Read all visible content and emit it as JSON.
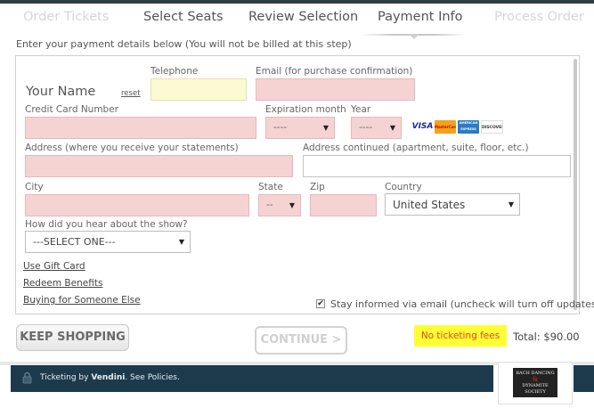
{
  "steps": [
    {
      "label": "Order Tickets",
      "state": "disabled"
    },
    {
      "label": "Select Seats",
      "state": "normal"
    },
    {
      "label": "Review Selection",
      "state": "normal"
    },
    {
      "label": "Payment Info",
      "state": "active"
    },
    {
      "label": "Process Order",
      "state": "disabled"
    }
  ],
  "intro_text": "Enter your payment details below (You will not be billed at this step)",
  "form": {
    "your_name": "Your Name",
    "reset_link": "reset",
    "telephone_label": "Telephone",
    "email_label": "Email (for purchase confirmation)",
    "card_number_label": "Credit Card Number",
    "expiration_month_label": "Expiration month",
    "expiration_month_value": "----",
    "year_label": "Year",
    "year_value": "----",
    "card_brands": [
      "VISA",
      "MasterCard",
      "AMERICAN EXPRESS",
      "DISCOVER"
    ],
    "address_label": "Address (where you receive your statements)",
    "address2_label": "Address continued (apartment, suite, floor, etc.)",
    "city_label": "City",
    "state_label": "State",
    "state_value": "--",
    "zip_label": "Zip",
    "country_label": "Country",
    "country_value": "United States",
    "hear_label": "How did you hear about the show?",
    "hear_value": "---SELECT ONE---",
    "gift_card_link": "Use Gift Card",
    "redeem_link": "Redeem Benefits",
    "buying_link": "Buying for Someone Else",
    "stay_informed_checked": true,
    "stay_informed_label": "Stay informed via email (uncheck will turn off updates)"
  },
  "actions": {
    "keep_shopping": "KEEP SHOPPING",
    "continue": "CONTINUE >",
    "no_fees": "No ticketing fees",
    "total": "Total: $90.00"
  },
  "footer": {
    "ticketing_by": "Ticketing by ",
    "vendor": "Vendini",
    "policies": ". See Policies.",
    "logo_lines": [
      "BACH DANCING",
      "&",
      "DYNAMITE SOCIETY"
    ]
  },
  "colors": {
    "required_field": "#f6d3d3",
    "telephone_field": "#fbfad3",
    "footer_bg": "#1d3a4c",
    "no_fees_bg": "#ffff33",
    "no_fees_text": "#e0442a"
  }
}
